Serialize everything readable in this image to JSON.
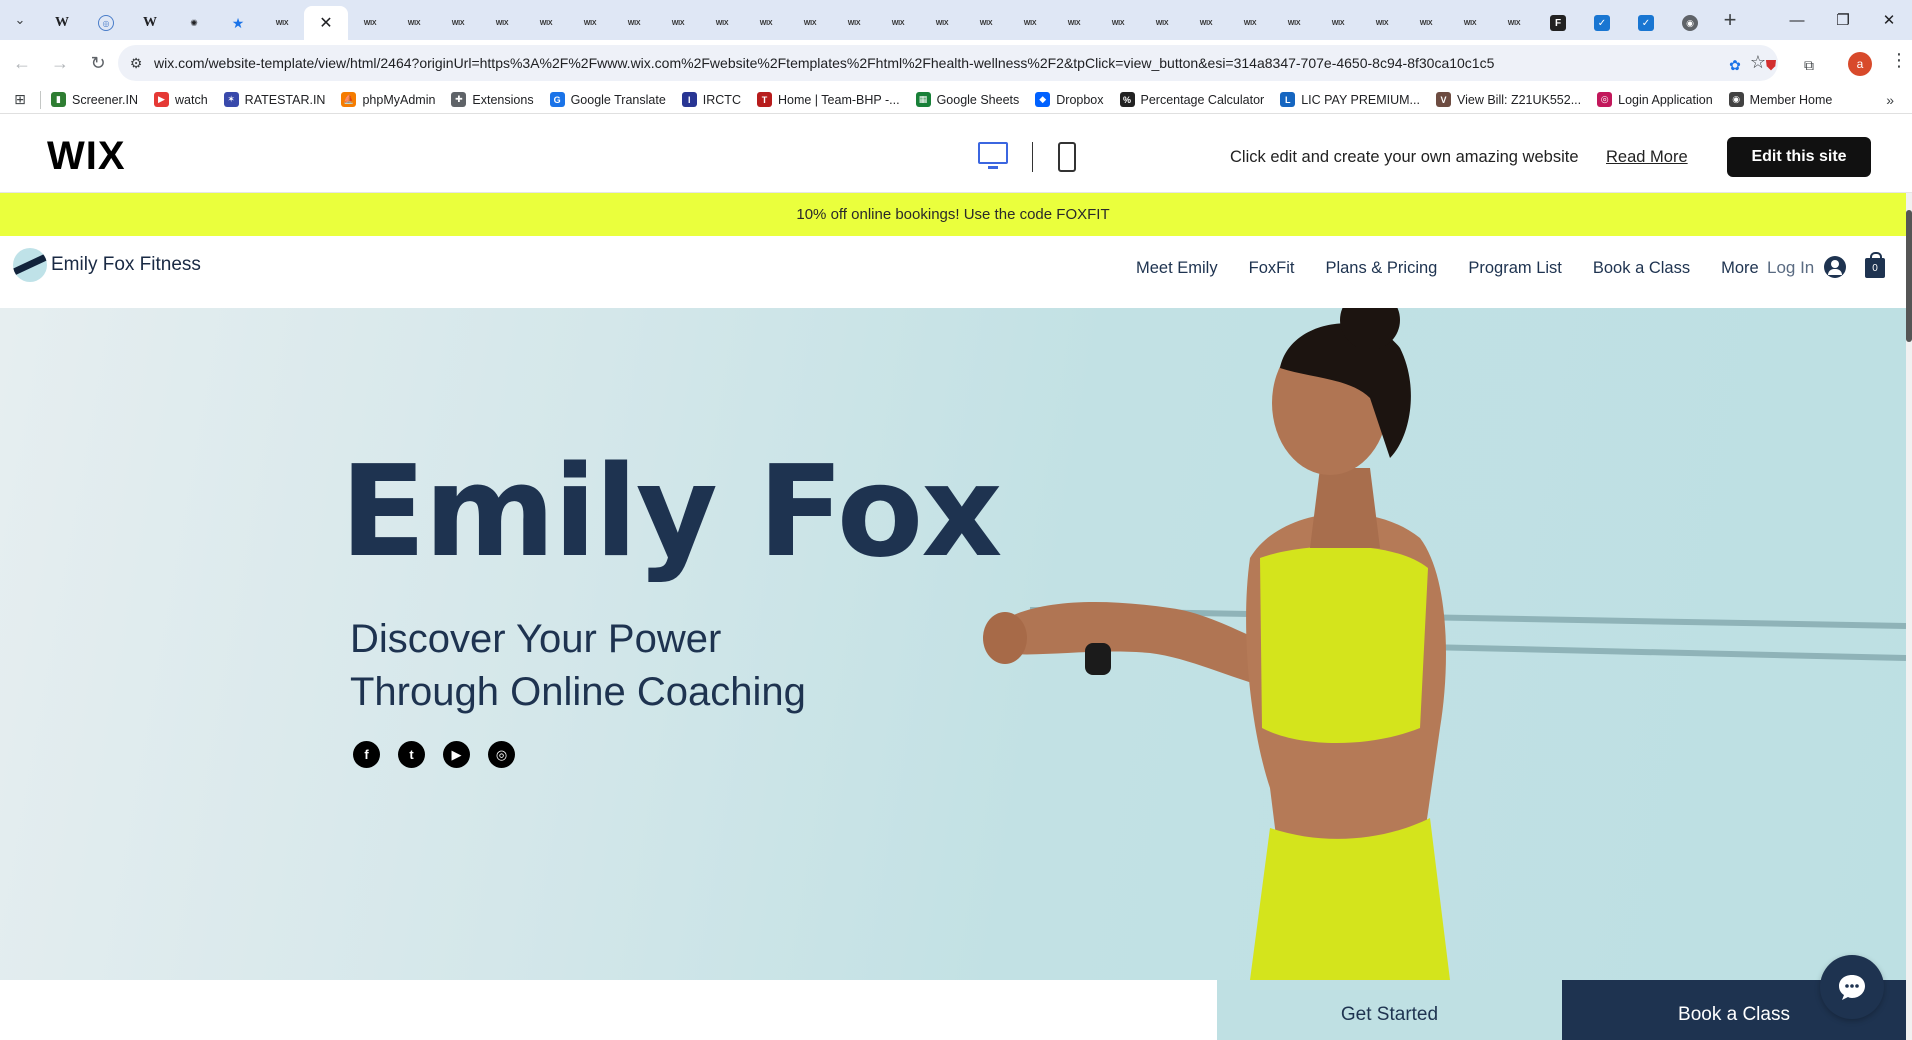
{
  "browser": {
    "tabs": [
      {
        "icon": "wikipedia-favicon",
        "glyph": "W"
      },
      {
        "icon": "un-favicon",
        "glyph": "◎"
      },
      {
        "icon": "wikipedia-favicon",
        "glyph": "W"
      },
      {
        "icon": "openai-favicon",
        "glyph": "✺"
      },
      {
        "icon": "star-favicon",
        "glyph": "★"
      },
      {
        "icon": "wix-favicon",
        "glyph": "WIX"
      },
      {
        "icon": "close-icon",
        "glyph": "✕",
        "active": true
      },
      {
        "icon": "wix-favicon",
        "glyph": "WIX"
      },
      {
        "icon": "wix-favicon",
        "glyph": "WIX"
      },
      {
        "icon": "wix-favicon",
        "glyph": "WIX"
      },
      {
        "icon": "wix-favicon",
        "glyph": "WIX"
      },
      {
        "icon": "wix-favicon",
        "glyph": "WIX"
      },
      {
        "icon": "wix-favicon",
        "glyph": "WIX"
      },
      {
        "icon": "wix-favicon",
        "glyph": "WIX"
      },
      {
        "icon": "wix-favicon",
        "glyph": "WIX"
      },
      {
        "icon": "wix-favicon",
        "glyph": "WIX"
      },
      {
        "icon": "wix-favicon",
        "glyph": "WIX"
      },
      {
        "icon": "wix-favicon",
        "glyph": "WIX"
      },
      {
        "icon": "wix-favicon",
        "glyph": "WIX"
      },
      {
        "icon": "wix-favicon",
        "glyph": "WIX"
      },
      {
        "icon": "wix-favicon",
        "glyph": "WIX"
      },
      {
        "icon": "wix-favicon",
        "glyph": "WIX"
      },
      {
        "icon": "wix-favicon",
        "glyph": "WIX"
      },
      {
        "icon": "wix-favicon",
        "glyph": "WIX"
      },
      {
        "icon": "wix-favicon",
        "glyph": "WIX"
      },
      {
        "icon": "wix-favicon",
        "glyph": "WIX"
      },
      {
        "icon": "wix-favicon",
        "glyph": "WIX"
      },
      {
        "icon": "wix-favicon",
        "glyph": "WIX"
      },
      {
        "icon": "wix-favicon",
        "glyph": "WIX"
      },
      {
        "icon": "wix-favicon",
        "glyph": "WIX"
      },
      {
        "icon": "wix-favicon",
        "glyph": "WIX"
      },
      {
        "icon": "wix-favicon",
        "glyph": "WIX"
      },
      {
        "icon": "wix-favicon",
        "glyph": "WIX"
      },
      {
        "icon": "wix-favicon",
        "glyph": "WIX"
      },
      {
        "icon": "flag-favicon",
        "glyph": "F"
      },
      {
        "icon": "blue-favicon",
        "glyph": "✓"
      },
      {
        "icon": "blue-favicon",
        "glyph": "✓"
      },
      {
        "icon": "chrome-favicon",
        "glyph": "◉"
      }
    ],
    "url": "wix.com/website-template/view/html/2464?originUrl=https%3A%2F%2Fwww.wix.com%2Fwebsite%2Ftemplates%2Fhtml%2Fhealth-wellness%2F2&tpClick=view_button&esi=314a8347-707e-4650-8c94-8f30ca10c1c5",
    "profile_initial": "a",
    "bookmarks": [
      {
        "label": "Screener.IN",
        "color": "#2e7d32",
        "glyph": "▮"
      },
      {
        "label": "watch",
        "color": "#e53935",
        "glyph": "▶"
      },
      {
        "label": "RATESTAR.IN",
        "color": "#3949ab",
        "glyph": "✶"
      },
      {
        "label": "phpMyAdmin",
        "color": "#f57c00",
        "glyph": "⛵"
      },
      {
        "label": "Extensions",
        "color": "#5f6368",
        "glyph": "✚"
      },
      {
        "label": "Google Translate",
        "color": "#1a73e8",
        "glyph": "G"
      },
      {
        "label": "IRCTC",
        "color": "#283593",
        "glyph": "I"
      },
      {
        "label": "Home | Team-BHP -...",
        "color": "#b71c1c",
        "glyph": "T"
      },
      {
        "label": "Google Sheets",
        "color": "#188038",
        "glyph": "▦"
      },
      {
        "label": "Dropbox",
        "color": "#0061ff",
        "glyph": "◆"
      },
      {
        "label": "Percentage Calculator",
        "color": "#222222",
        "glyph": "%"
      },
      {
        "label": "LIC PAY PREMIUM...",
        "color": "#1565c0",
        "glyph": "L"
      },
      {
        "label": "View Bill: Z21UK552...",
        "color": "#6d4c41",
        "glyph": "V"
      },
      {
        "label": "Login Application",
        "color": "#c2185b",
        "glyph": "◎"
      },
      {
        "label": "Member Home",
        "color": "#424242",
        "glyph": "◉"
      }
    ]
  },
  "wix_bar": {
    "logo": "WIX",
    "tagline": "Click edit and create your own amazing website",
    "read_more": "Read More",
    "edit_button": "Edit this site"
  },
  "site": {
    "promo": "10% off online bookings! Use the code FOXFIT",
    "brand": "Emily Fox Fitness",
    "nav": [
      "Meet Emily",
      "FoxFit",
      "Plans & Pricing",
      "Program List",
      "Book a Class",
      "More"
    ],
    "login": "Log In",
    "cart_count": "0",
    "hero_title": "Emily Fox",
    "hero_sub_line1": "Discover Your Power",
    "hero_sub_line2": "Through Online Coaching",
    "socials": [
      {
        "icon": "facebook-icon",
        "glyph": "f"
      },
      {
        "icon": "twitter-icon",
        "glyph": "t"
      },
      {
        "icon": "youtube-icon",
        "glyph": "▶"
      },
      {
        "icon": "instagram-icon",
        "glyph": "◎"
      }
    ],
    "cta_start": "Get Started",
    "cta_book": "Book a Class"
  },
  "colors": {
    "navy": "#1e3350",
    "promo_yellow": "#eaff3d",
    "hero_bg": "#bde0e3",
    "outfit_lime": "#d4e41c"
  }
}
